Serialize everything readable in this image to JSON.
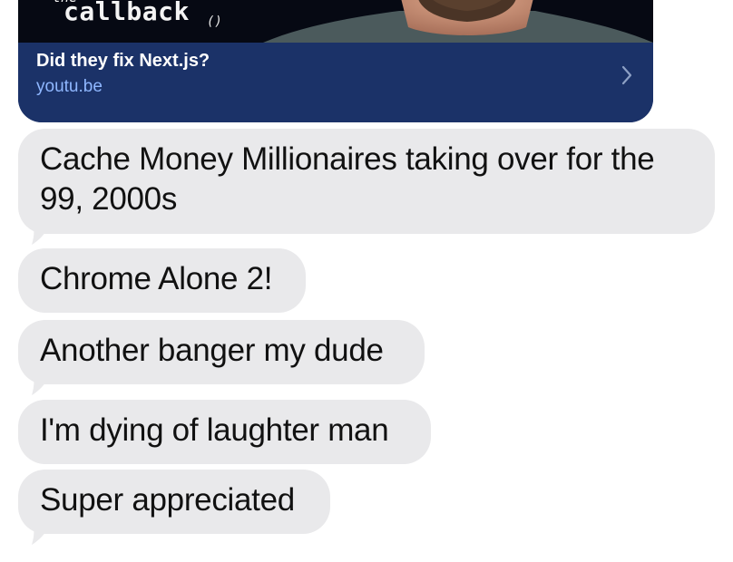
{
  "link_preview": {
    "thumbnail_text_top": "the",
    "thumbnail_text_main": "callback",
    "thumbnail_text_parens": "()",
    "title": "Did they fix Next.js?",
    "domain": "youtu.be",
    "chevron_icon": "chevron-right-icon"
  },
  "messages": [
    {
      "text": "Cache Money Millionaires taking over for the 99, 2000s",
      "tail": true
    },
    {
      "text": "Chrome Alone 2!",
      "tail": false
    },
    {
      "text": "Another banger my dude",
      "tail": true
    },
    {
      "text": "I'm dying of laughter man",
      "tail": false
    },
    {
      "text": "Super appreciated",
      "tail": true
    }
  ],
  "colors": {
    "bubble_gray": "#e9e9eb",
    "card_navy": "#1b3268",
    "link_blue": "#8fb7ff"
  }
}
